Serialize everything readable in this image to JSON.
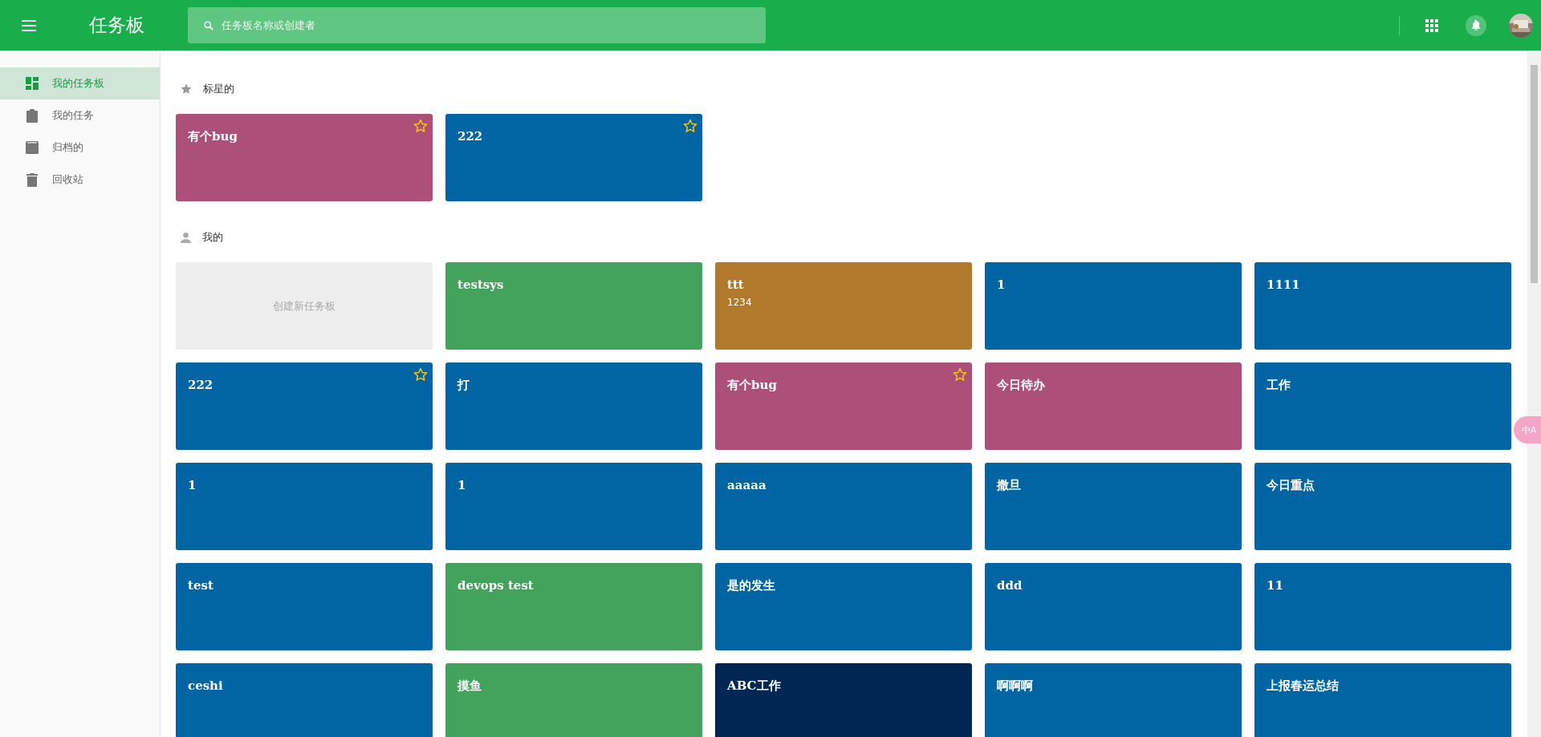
{
  "header": {
    "title": "任务板",
    "search": {
      "placeholder": "任务板名称或创建者"
    }
  },
  "sidebar": {
    "items": [
      {
        "label": "我的任务板",
        "kind": "dashboard",
        "selected": true
      },
      {
        "label": "我的任务",
        "kind": "clipboard",
        "selected": false
      },
      {
        "label": "归档的",
        "kind": "archive",
        "selected": false
      },
      {
        "label": "回收站",
        "kind": "trash",
        "selected": false
      }
    ]
  },
  "sections": [
    {
      "title": "标星的",
      "kind": "starred",
      "boards": [
        {
          "kind": "board",
          "title": "有个bug",
          "color": "#ad5079",
          "starred": true
        },
        {
          "kind": "board",
          "title": "222",
          "color": "#0065a2",
          "starred": true
        }
      ]
    },
    {
      "title": "我的",
      "kind": "mine",
      "boards": [
        {
          "kind": "create",
          "title": "创建新任务板"
        },
        {
          "kind": "board",
          "title": "testsys",
          "color": "#43a35c",
          "starred": false
        },
        {
          "kind": "board",
          "title": "ttt",
          "subtitle": "1234",
          "color": "#b0792b",
          "starred": false
        },
        {
          "kind": "board",
          "title": "1",
          "color": "#0065a2",
          "starred": false
        },
        {
          "kind": "board",
          "title": "1111",
          "color": "#0065a2",
          "starred": false
        },
        {
          "kind": "board",
          "title": "222",
          "color": "#0065a2",
          "starred": true
        },
        {
          "kind": "board",
          "title": "打",
          "color": "#0065a2",
          "starred": false
        },
        {
          "kind": "board",
          "title": "有个bug",
          "color": "#ad5079",
          "starred": true
        },
        {
          "kind": "board",
          "title": "今日待办",
          "color": "#ad5079",
          "starred": false
        },
        {
          "kind": "board",
          "title": "工作",
          "color": "#0065a2",
          "starred": false
        },
        {
          "kind": "board",
          "title": "1",
          "color": "#0065a2",
          "starred": false
        },
        {
          "kind": "board",
          "title": "1",
          "color": "#0065a2",
          "starred": false
        },
        {
          "kind": "board",
          "title": "aaaaa",
          "color": "#0065a2",
          "starred": false
        },
        {
          "kind": "board",
          "title": "撒旦",
          "color": "#0065a2",
          "starred": false
        },
        {
          "kind": "board",
          "title": "今日重点",
          "color": "#0065a2",
          "starred": false
        },
        {
          "kind": "board",
          "title": "test",
          "color": "#0065a2",
          "starred": false
        },
        {
          "kind": "board",
          "title": "devops test",
          "color": "#43a35c",
          "starred": false
        },
        {
          "kind": "board",
          "title": "是的发生",
          "color": "#0065a2",
          "starred": false
        },
        {
          "kind": "board",
          "title": "ddd",
          "color": "#0065a2",
          "starred": false
        },
        {
          "kind": "board",
          "title": "11",
          "color": "#0065a2",
          "starred": false
        },
        {
          "kind": "board",
          "title": "ceshi",
          "color": "#0065a2",
          "starred": false
        },
        {
          "kind": "board",
          "title": "摸鱼",
          "color": "#43a35c",
          "starred": false
        },
        {
          "kind": "board",
          "title": "ABC工作",
          "color": "#002653",
          "starred": false
        },
        {
          "kind": "board",
          "title": "啊啊啊",
          "color": "#0065a2",
          "starred": false
        },
        {
          "kind": "board",
          "title": "上报春运总结",
          "color": "#0065a2",
          "starred": false
        }
      ]
    }
  ],
  "translate_button": {
    "label": "中A"
  }
}
